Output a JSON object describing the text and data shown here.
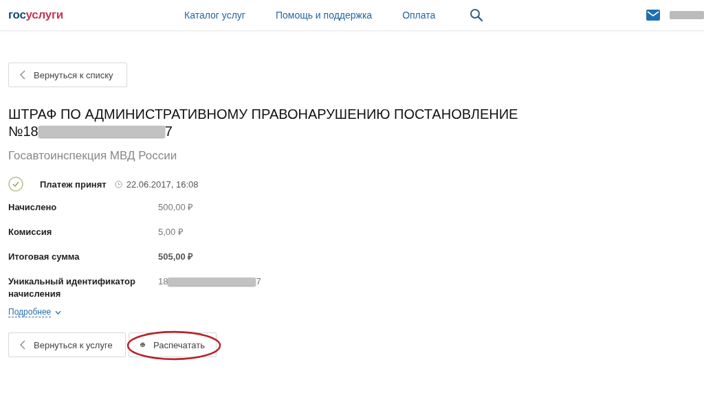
{
  "header": {
    "logo": [
      {
        "text": "гос"
      },
      {
        "text": "услуги"
      }
    ],
    "nav": [
      {
        "label": "Каталог услуг"
      },
      {
        "label": "Помощь и поддержка"
      },
      {
        "label": "Оплата"
      }
    ]
  },
  "back_button": {
    "label": "Вернуться к списку"
  },
  "title": {
    "line1": "ШТРАФ ПО АДМИНИСТРАТИВНОМУ ПРАВОНАРУШЕНИЮ ПОСТАНОВЛЕНИЕ",
    "number_start": "№18",
    "number_end": "7"
  },
  "agency": "Госавтоинспекция МВД России",
  "status": {
    "label": "Платеж принят",
    "datetime": "22.06.2017, 16:08"
  },
  "details": [
    {
      "kind": "amount",
      "label": "Начислено",
      "value": "500,00 ₽",
      "bold": false
    },
    {
      "kind": "amount",
      "label": "Комиссия",
      "value": "5,00 ₽",
      "bold": false
    },
    {
      "kind": "amount",
      "label": "Итоговая сумма",
      "value": "505,00 ₽",
      "bold": true
    },
    {
      "kind": "redacted",
      "label": "Уникальный идентификатор начисления",
      "value_start": "18",
      "value_end": "7"
    }
  ],
  "more_link": {
    "label": "Подробнее"
  },
  "buttons": [
    {
      "kind": "back",
      "label": "Вернуться к услуге",
      "highlighted": false
    },
    {
      "kind": "print",
      "label": "Распечатать",
      "highlighted": true
    }
  ]
}
